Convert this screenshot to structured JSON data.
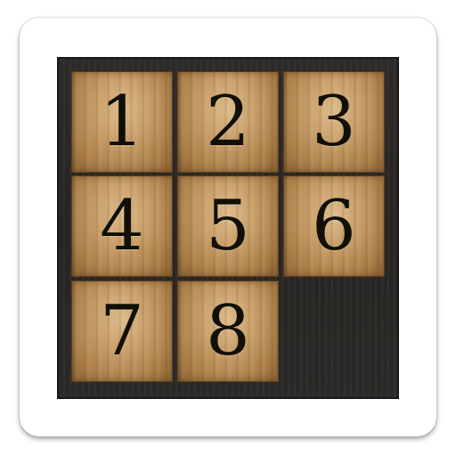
{
  "puzzle": {
    "tiles": [
      {
        "label": "1",
        "row": 0,
        "col": 0
      },
      {
        "label": "2",
        "row": 0,
        "col": 1
      },
      {
        "label": "3",
        "row": 0,
        "col": 2
      },
      {
        "label": "4",
        "row": 1,
        "col": 0
      },
      {
        "label": "5",
        "row": 1,
        "col": 1
      },
      {
        "label": "6",
        "row": 1,
        "col": 2
      },
      {
        "label": "7",
        "row": 2,
        "col": 0
      },
      {
        "label": "8",
        "row": 2,
        "col": 1
      }
    ],
    "empty": {
      "row": 2,
      "col": 2
    },
    "grid_size": 3
  }
}
